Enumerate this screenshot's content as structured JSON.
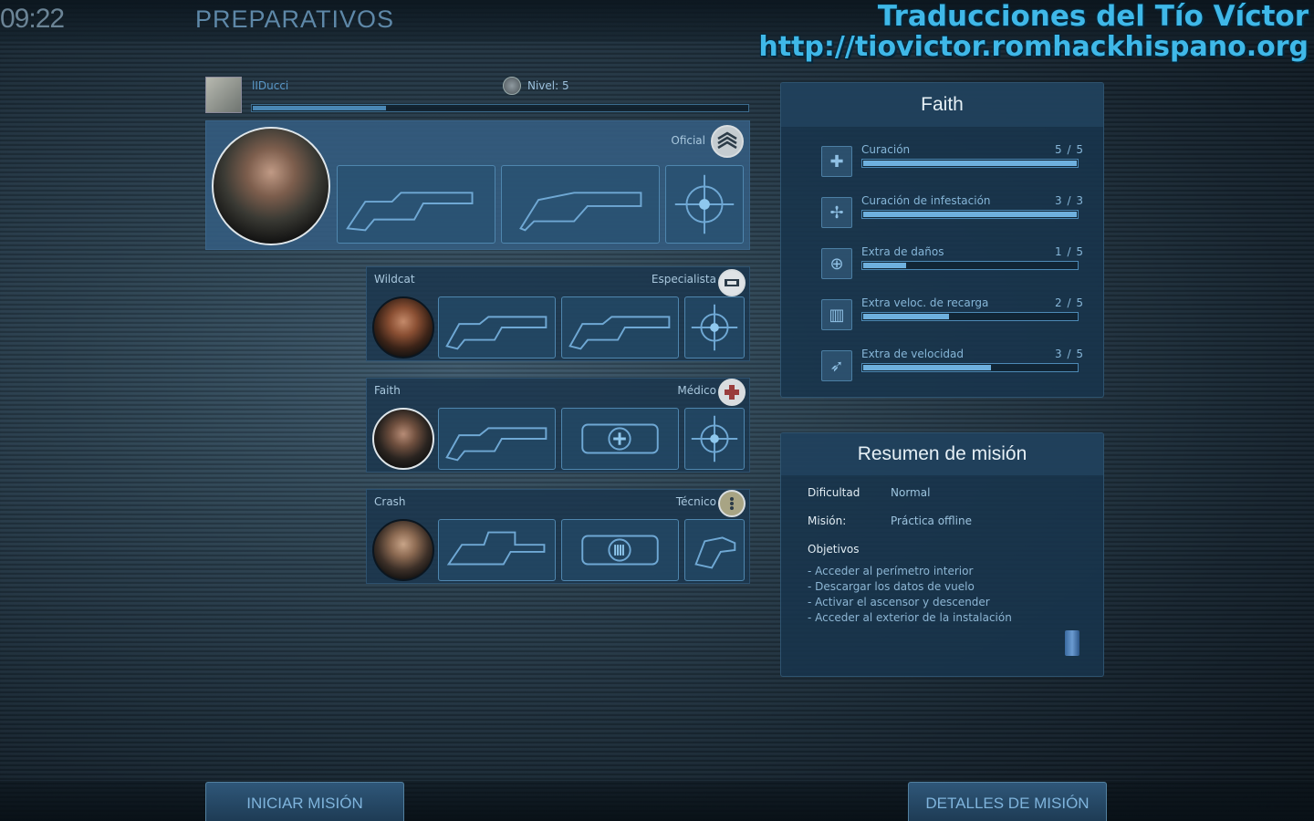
{
  "header": {
    "clock": "09:22",
    "title": "PREPARATIVOS",
    "watermark_line1": "Traducciones del Tío Víctor",
    "watermark_line2": "http://tiovictor.romhackhispano.org"
  },
  "player": {
    "name": "lIDucci",
    "level": "Nivel: 5",
    "xp_fraction": 0.27
  },
  "squad": [
    {
      "name": "",
      "class": "Oficial",
      "class_icon": "officer-rank-icon",
      "slots": [
        "assault-rifle-icon",
        "shotgun-icon",
        "crosshair-skill-icon"
      ]
    },
    {
      "name": "Wildcat",
      "class": "Especialista",
      "class_icon": "specialist-gun-icon",
      "slots": [
        "minigun-icon",
        "assault-rifle-icon",
        "crosshair-skill-icon"
      ]
    },
    {
      "name": "Faith",
      "class": "Médico",
      "class_icon": "medic-cross-icon",
      "slots": [
        "assault-rifle-icon",
        "medkit-icon",
        "crosshair-skill-icon"
      ]
    },
    {
      "name": "Crash",
      "class": "Técnico",
      "class_icon": "tech-wrench-icon",
      "slots": [
        "smg-icon",
        "ammo-pack-icon",
        "sentry-gun-icon"
      ]
    }
  ],
  "skills_panel": {
    "title": "Faith",
    "skills": [
      {
        "name": "Curación",
        "value": "5 / 5",
        "current": 5,
        "max": 5,
        "icon": "heal-cross-icon"
      },
      {
        "name": "Curación de infestación",
        "value": "3 / 3",
        "current": 3,
        "max": 3,
        "icon": "infestation-heal-icon"
      },
      {
        "name": "Extra de daños",
        "value": "1 / 5",
        "current": 1,
        "max": 5,
        "icon": "damage-target-icon"
      },
      {
        "name": "Extra veloc. de recarga",
        "value": "2 / 5",
        "current": 2,
        "max": 5,
        "icon": "reload-speed-icon"
      },
      {
        "name": "Extra de velocidad",
        "value": "3 / 5",
        "current": 3,
        "max": 5,
        "icon": "run-speed-icon"
      }
    ]
  },
  "summary": {
    "title": "Resumen de misión",
    "difficulty_label": "Dificultad",
    "difficulty_value": "Normal",
    "mission_label": "Misión:",
    "mission_value": "Práctica offline",
    "objectives_label": "Objetivos",
    "objectives": [
      "- Acceder al perímetro interior",
      "- Descargar los datos de vuelo",
      "- Activar el ascensor y descender",
      "- Acceder al exterior de la instalación"
    ]
  },
  "buttons": {
    "start": "INICIAR MISIÓN",
    "details": "DETALLES DE MISIÓN"
  },
  "colors": {
    "accent": "#6eb0de",
    "panel": "#1c3a54",
    "watermark": "#3fb8e8"
  }
}
